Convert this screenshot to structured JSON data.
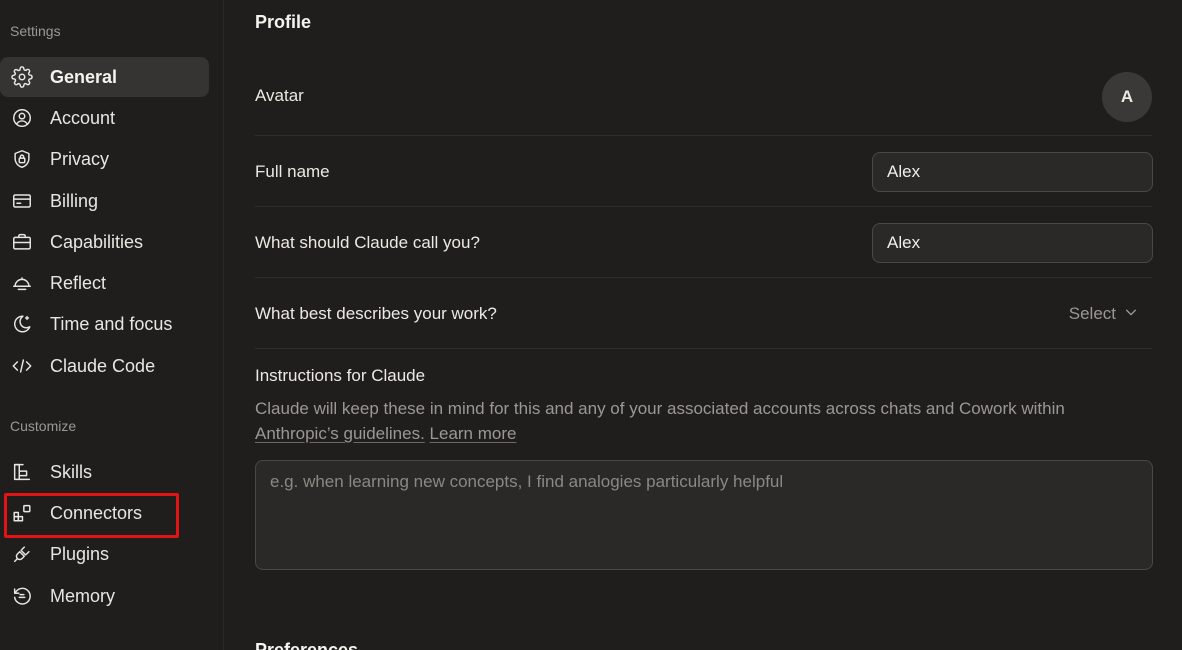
{
  "sidebar": {
    "settings_label": "Settings",
    "customize_label": "Customize",
    "settings_items": [
      {
        "label": "General",
        "icon": "gear-icon",
        "active": true
      },
      {
        "label": "Account",
        "icon": "user-circle-icon"
      },
      {
        "label": "Privacy",
        "icon": "shield-lock-icon"
      },
      {
        "label": "Billing",
        "icon": "credit-card-icon"
      },
      {
        "label": "Capabilities",
        "icon": "briefcase-icon"
      },
      {
        "label": "Reflect",
        "icon": "bell-icon"
      },
      {
        "label": "Time and focus",
        "icon": "moon-icon"
      },
      {
        "label": "Claude Code",
        "icon": "code-icon"
      }
    ],
    "customize_items": [
      {
        "label": "Skills",
        "icon": "skills-icon"
      },
      {
        "label": "Connectors",
        "icon": "connectors-icon",
        "highlighted": true
      },
      {
        "label": "Plugins",
        "icon": "plug-icon"
      },
      {
        "label": "Memory",
        "icon": "history-icon"
      }
    ]
  },
  "main": {
    "profile_heading": "Profile",
    "avatar": {
      "label": "Avatar",
      "initial": "A"
    },
    "full_name": {
      "label": "Full name",
      "value": "Alex"
    },
    "call_name": {
      "label": "What should Claude call you?",
      "value": "Alex"
    },
    "work": {
      "label": "What best describes your work?",
      "value": "Select"
    },
    "instructions": {
      "title": "Instructions for Claude",
      "description": "Claude will keep these in mind for this and any of your associated accounts across chats and Cowork within",
      "guidelines_link": "Anthropic’s guidelines.",
      "learn_more": "Learn more",
      "placeholder": "e.g. when learning new concepts, I find analogies particularly helpful"
    },
    "next_heading": "Preferences"
  },
  "colors": {
    "background": "#1f1e1d",
    "active_item": "#353432",
    "highlight": "#e01414",
    "muted_text": "#9b9893"
  }
}
